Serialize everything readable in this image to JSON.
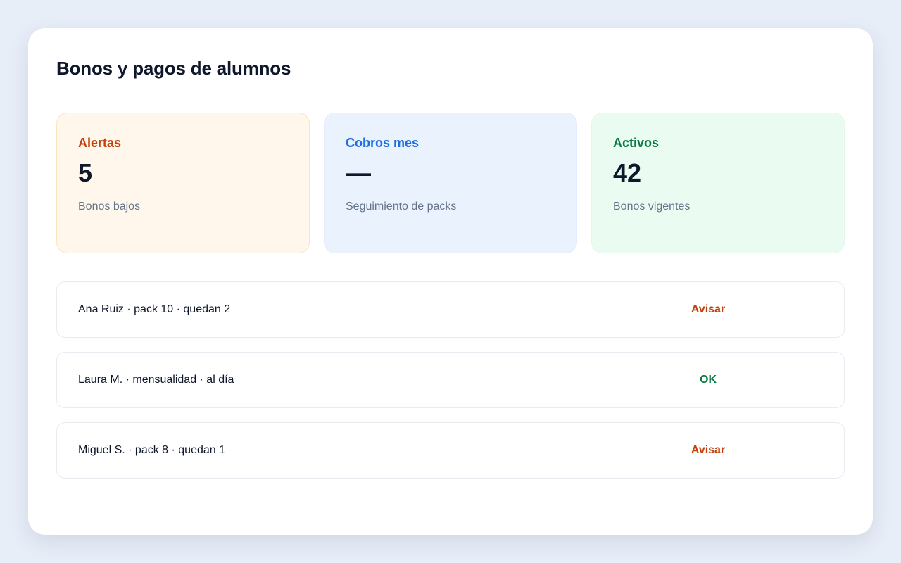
{
  "page": {
    "title": "Bonos y pagos de alumnos"
  },
  "stats": [
    {
      "label": "Alertas",
      "value": "5",
      "sub": "Bonos bajos",
      "color": "#c2410c",
      "background": "#fff7eb"
    },
    {
      "label": "Cobros mes",
      "value": "—",
      "sub": "Seguimiento de packs",
      "color": "#1d6fe0",
      "background": "#eaf2fe"
    },
    {
      "label": "Activos",
      "value": "42",
      "sub": "Bonos vigentes",
      "color": "#0d7a44",
      "background": "#eafcf2"
    }
  ],
  "rows": [
    {
      "text": "Ana Ruiz · pack 10 · quedan 2",
      "action": "Avisar",
      "status": "warn"
    },
    {
      "text": "Laura M. · mensualidad · al día",
      "action": "OK",
      "status": "ok"
    },
    {
      "text": "Miguel S. · pack 8 · quedan 1",
      "action": "Avisar",
      "status": "warn"
    }
  ]
}
